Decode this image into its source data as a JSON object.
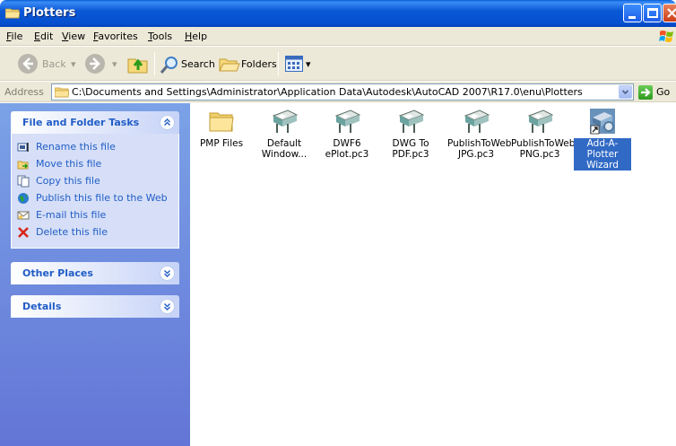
{
  "window": {
    "title": "Plotters"
  },
  "menu": [
    {
      "u": "F",
      "rest": "ile"
    },
    {
      "u": "E",
      "rest": "dit"
    },
    {
      "u": "V",
      "rest": "iew"
    },
    {
      "u": "",
      "pre": "F",
      "rest": "avorites",
      "label": "Favorites"
    },
    {
      "u": "T",
      "rest": "ools"
    },
    {
      "u": "H",
      "rest": "elp"
    }
  ],
  "toolbar": {
    "back": "Back",
    "search": "Search",
    "folders": "Folders"
  },
  "address": {
    "label": "Address",
    "path": "C:\\Documents and Settings\\Administrator\\Application Data\\Autodesk\\AutoCAD 2007\\R17.0\\enu\\Plotters",
    "go": "Go"
  },
  "panels": {
    "tasks": {
      "title": "File and Folder Tasks",
      "items": [
        {
          "label": "Rename this file",
          "icon": "rename-icon"
        },
        {
          "label": "Move this file",
          "icon": "move-icon"
        },
        {
          "label": "Copy this file",
          "icon": "copy-icon"
        },
        {
          "label": "Publish this file to the Web",
          "icon": "globe-icon"
        },
        {
          "label": "E-mail this file",
          "icon": "email-icon"
        },
        {
          "label": "Delete this file",
          "icon": "delete-icon"
        }
      ]
    },
    "other": {
      "title": "Other Places"
    },
    "details": {
      "title": "Details"
    }
  },
  "files": [
    {
      "name": "PMP Files",
      "type": "folder"
    },
    {
      "name": "Default\nWindow...",
      "type": "plotter"
    },
    {
      "name": "DWF6\nePlot.pc3",
      "type": "plotter"
    },
    {
      "name": "DWG To\nPDF.pc3",
      "type": "plotter"
    },
    {
      "name": "PublishToWeb\nJPG.pc3",
      "type": "plotter"
    },
    {
      "name": "PublishToWeb\nPNG.pc3",
      "type": "plotter"
    },
    {
      "name": "Add-A-Plotter\nWizard",
      "type": "shortcut",
      "selected": true
    }
  ],
  "colors": {
    "accent": "#215dc6",
    "selection": "#316ac5",
    "titlebar": "#0550cf"
  }
}
